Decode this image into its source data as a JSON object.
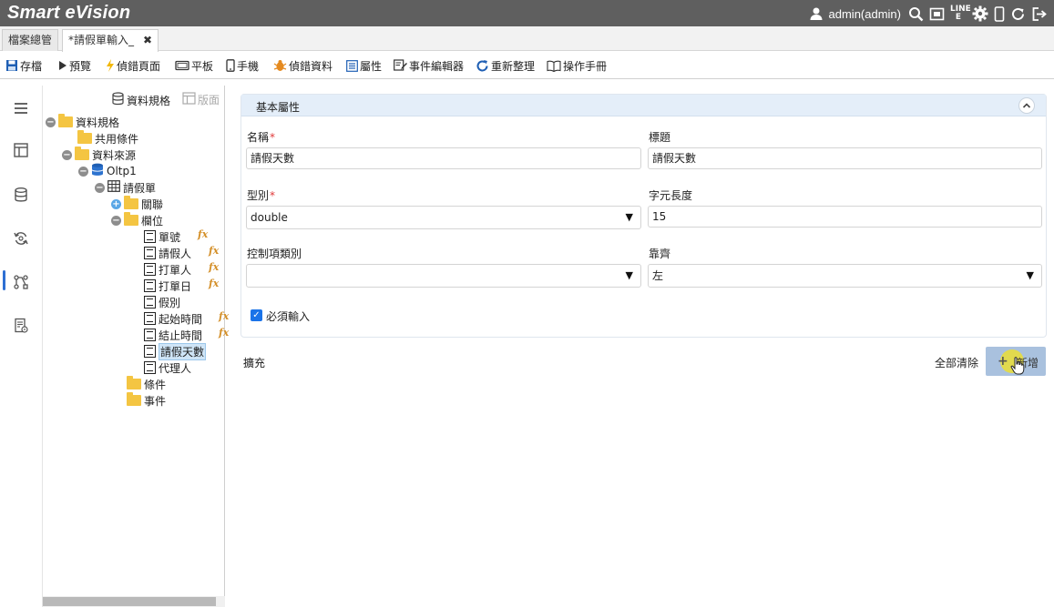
{
  "app": {
    "title": "Smart eVision",
    "user": "admin(admin)",
    "line_label_top": "LINE",
    "line_label_bottom": "E"
  },
  "tabs": [
    {
      "label": "檔案總管",
      "active": false
    },
    {
      "label": "*請假單輸入_",
      "active": true,
      "close": "✖"
    }
  ],
  "toolbar": {
    "save": "存檔",
    "preview": "預覽",
    "debug_page": "偵錯頁面",
    "tablet": "平板",
    "phone": "手機",
    "debug_data": "偵錯資料",
    "properties": "屬性",
    "event_editor": "事件編輯器",
    "reorganize": "重新整理",
    "manual": "操作手冊"
  },
  "tree_panel": {
    "data_spec_btn": "資料規格",
    "layout_btn": "版面",
    "nodes": {
      "root": "資料規格",
      "shared": "共用條件",
      "datasource": "資料來源",
      "db": "Oltp1",
      "table": "請假單",
      "relations": "關聯",
      "fields": "欄位",
      "f1": "單號",
      "f2": "請假人",
      "f3": "打單人",
      "f4": "打單日",
      "f5": "假別",
      "f6": "起始時間",
      "f7": "結止時間",
      "f8": "請假天數",
      "f9": "代理人",
      "conditions": "條件",
      "events": "事件"
    },
    "fx_label": "fx"
  },
  "form": {
    "section_title": "基本屬性",
    "name_label": "名稱",
    "name_value": "請假天數",
    "title_label": "標題",
    "title_value": "請假天數",
    "type_label": "型別",
    "type_value": "double",
    "length_label": "字元長度",
    "length_value": "15",
    "control_label": "控制項類別",
    "control_value": "",
    "align_label": "靠齊",
    "align_value": "左",
    "required_checkbox_label": "必須輸入",
    "required_mark": "*",
    "required_checked": true
  },
  "actions": {
    "expand_label": "擴充",
    "clear_all": "全部清除",
    "add": "新增"
  },
  "colors": {
    "titlebar": "#5f5f5f",
    "accent": "#2d6fd3",
    "section_header": "#e4eef9",
    "add_button": "#a9c1de",
    "folder": "#f4c542",
    "fx": "#d4902a"
  }
}
